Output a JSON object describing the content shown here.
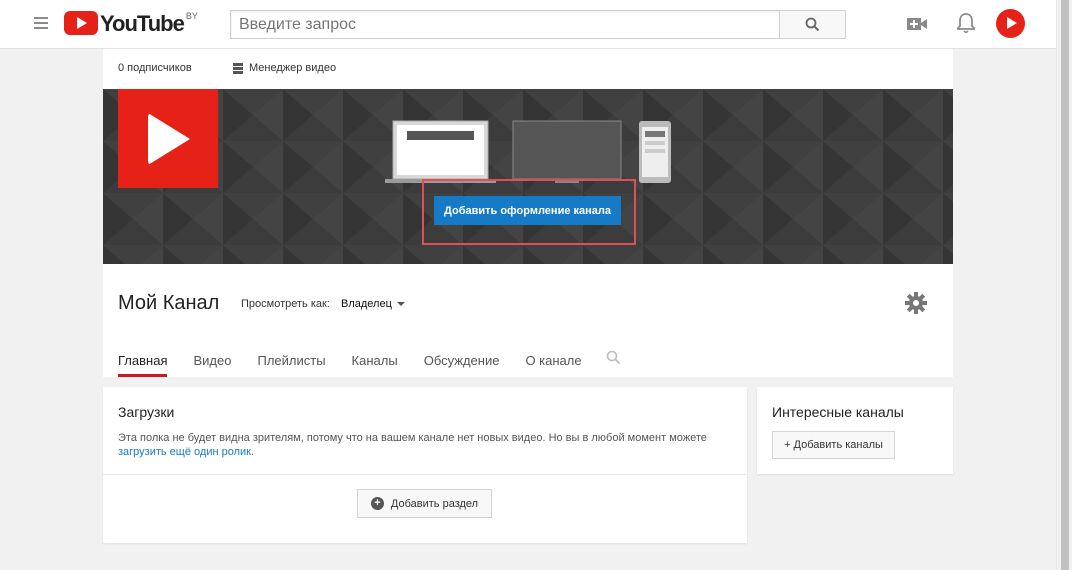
{
  "masthead": {
    "logo_text": "YouTube",
    "logo_region": "BY",
    "search_placeholder": "Введите запрос"
  },
  "channel": {
    "subscribers": "0 подписчиков",
    "video_manager": "Менеджер видео",
    "add_channel_art": "Добавить оформление канала",
    "title": "Мой Канал",
    "view_as_label": "Просмотреть как:",
    "view_as_value": "Владелец",
    "tabs": [
      {
        "label": "Главная",
        "active": true
      },
      {
        "label": "Видео",
        "active": false
      },
      {
        "label": "Плейлисты",
        "active": false
      },
      {
        "label": "Каналы",
        "active": false
      },
      {
        "label": "Обсуждение",
        "active": false
      },
      {
        "label": "О канале",
        "active": false
      }
    ]
  },
  "uploads": {
    "title": "Загрузки",
    "text_before": "Эта полка не будет видна зрителям, потому что на вашем канале нет новых видео. Но вы в любой момент можете ",
    "link": "загрузить ещё один ролик",
    "text_after": ".",
    "add_section": "Добавить раздел"
  },
  "featured": {
    "title": "Интересные каналы",
    "add_channels": "+ Добавить каналы"
  },
  "colors": {
    "brand_red": "#e62117",
    "accent_blue": "#167ac6",
    "highlight": "#e05050"
  }
}
